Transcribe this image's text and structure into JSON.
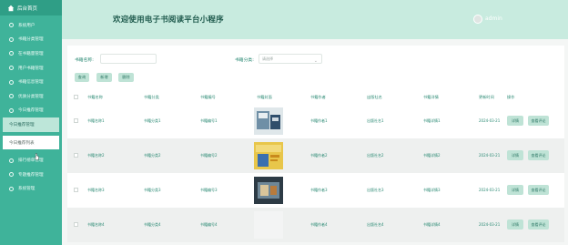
{
  "sidebar": {
    "home": "后台首页",
    "items": [
      {
        "label": "系统用户"
      },
      {
        "label": "书籍分类管理"
      },
      {
        "label": "在书籍量管理"
      },
      {
        "label": "用户书籍管理"
      },
      {
        "label": "书籍信息管理"
      },
      {
        "label": "优质分类管理"
      },
      {
        "label": "今日推荐管理"
      }
    ],
    "selected": "今日推荐管理",
    "subitem": "今日推荐列表",
    "more_items": [
      {
        "label": "排行榜单管理"
      },
      {
        "label": "专题推荐管理"
      },
      {
        "label": "系统管理"
      }
    ]
  },
  "header": {
    "title": "欢迎使用电子书阅读平台小程序",
    "username": "admin"
  },
  "filters": {
    "name_label": "书籍名称:",
    "name_placeholder": "",
    "category_label": "书籍分类:",
    "category_placeholder": "请选择"
  },
  "toolbar": {
    "search": "查询",
    "add": "新增",
    "delete": "删除"
  },
  "table": {
    "headers": [
      "书籍名称",
      "书籍分类",
      "书籍编号",
      "书籍封面",
      "书籍作者",
      "出版社名",
      "书籍详情",
      "更新时间",
      "操作"
    ],
    "rows": [
      {
        "name": "书籍名称1",
        "category": "书籍分类1",
        "code": "书籍编号1",
        "author": "书籍作者1",
        "publisher": "出版社名1",
        "detail": "书籍详情1",
        "time": "2024-03-21"
      },
      {
        "name": "书籍名称2",
        "category": "书籍分类2",
        "code": "书籍编号2",
        "author": "书籍作者2",
        "publisher": "出版社名2",
        "detail": "书籍详情2",
        "time": "2024-03-21"
      },
      {
        "name": "书籍名称3",
        "category": "书籍分类3",
        "code": "书籍编号3",
        "author": "书籍作者3",
        "publisher": "出版社名3",
        "detail": "书籍详情3",
        "time": "2024-03-21"
      },
      {
        "name": "书籍名称4",
        "category": "书籍分类4",
        "code": "书籍编号4",
        "author": "书籍作者4",
        "publisher": "出版社名4",
        "detail": "书籍详情4",
        "time": "2024-03-21"
      }
    ],
    "actions": {
      "detail": "详情",
      "comment": "查看评论"
    }
  },
  "colors": {
    "sidebar": "#3fb39a",
    "header": "#c8ebdf",
    "accent_text": "#2b8a74",
    "button": "#bfe3d6"
  }
}
